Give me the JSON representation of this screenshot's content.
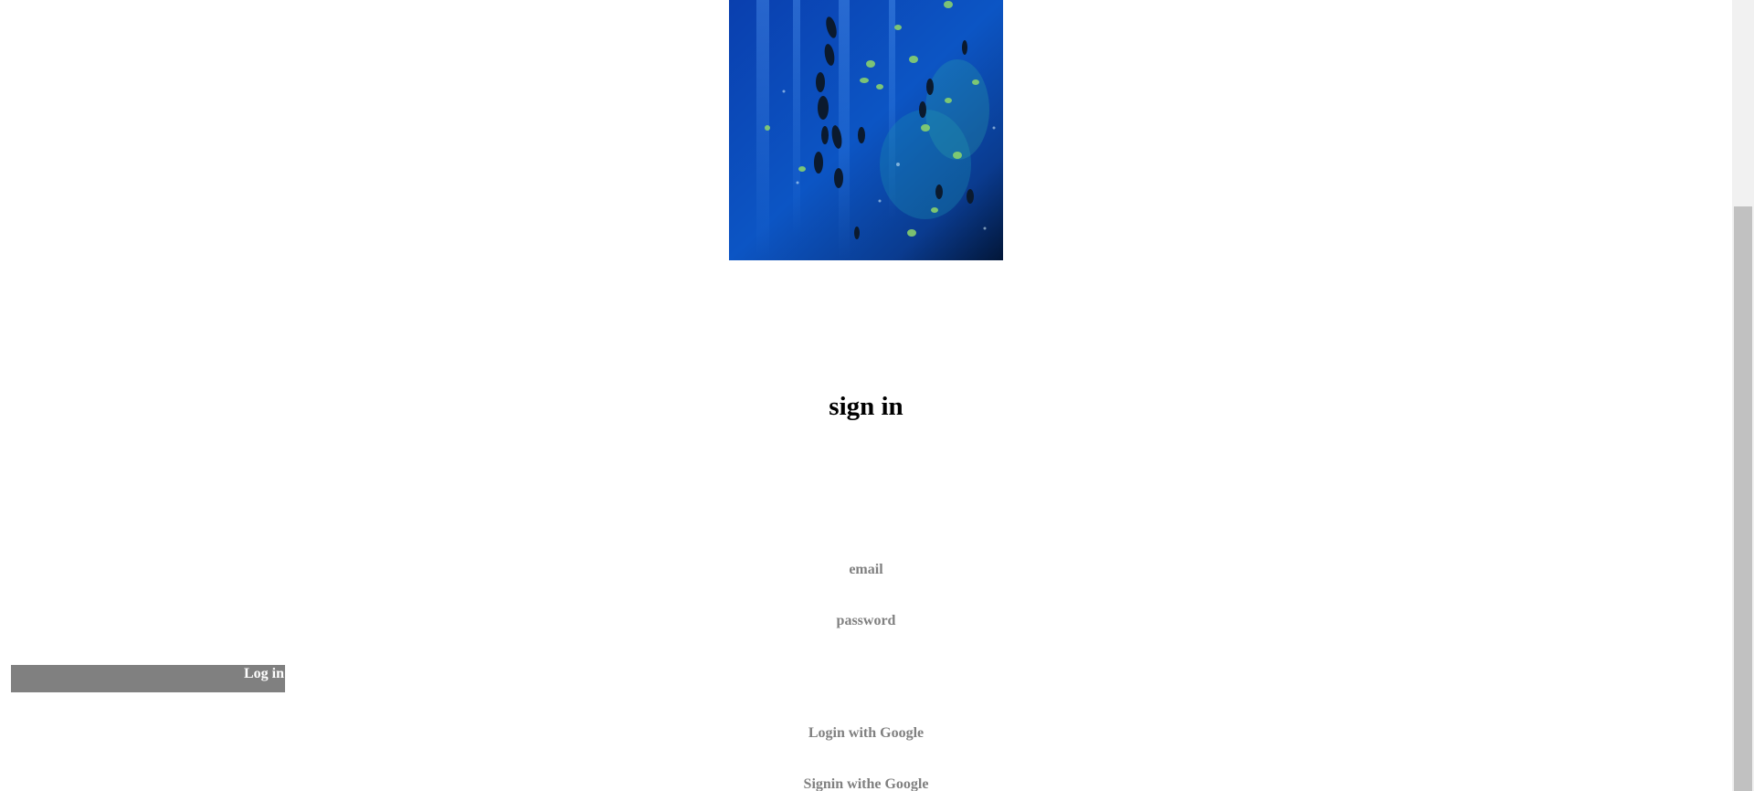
{
  "header": {
    "image_alt": "underwater fish"
  },
  "form": {
    "title": "sign in",
    "email_placeholder": "email",
    "password_placeholder": "password",
    "login_label": "Log in"
  },
  "links": {
    "google_login": "Login with Google",
    "google_signin": "Signin withe Google"
  },
  "colors": {
    "muted_text": "#808080",
    "button_bg": "#808080",
    "button_text": "#ffffff"
  }
}
